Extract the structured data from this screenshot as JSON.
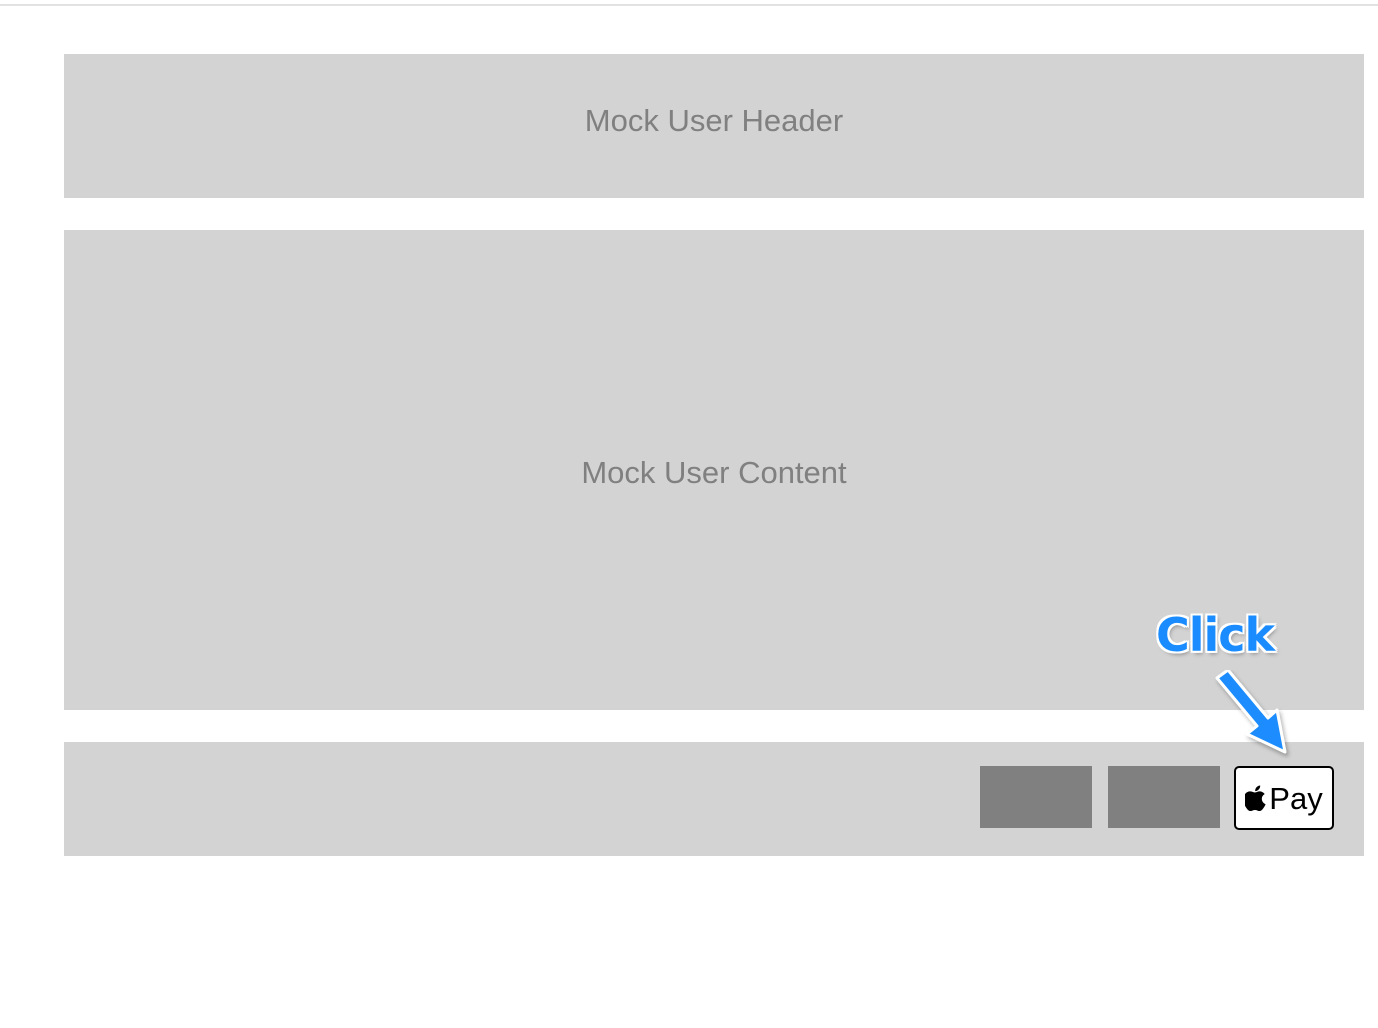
{
  "header": {
    "label": "Mock User Header"
  },
  "content": {
    "label": "Mock User Content"
  },
  "footer": {
    "apple_pay": {
      "icon": "apple-logo-icon",
      "label": "Pay"
    }
  },
  "annotation": {
    "text": "Click",
    "icon": "arrow-down-right-icon",
    "color": "#1a8cff"
  },
  "colors": {
    "panel": "#d3d3d3",
    "panel_text": "#808080",
    "placeholder_button": "#808080"
  }
}
